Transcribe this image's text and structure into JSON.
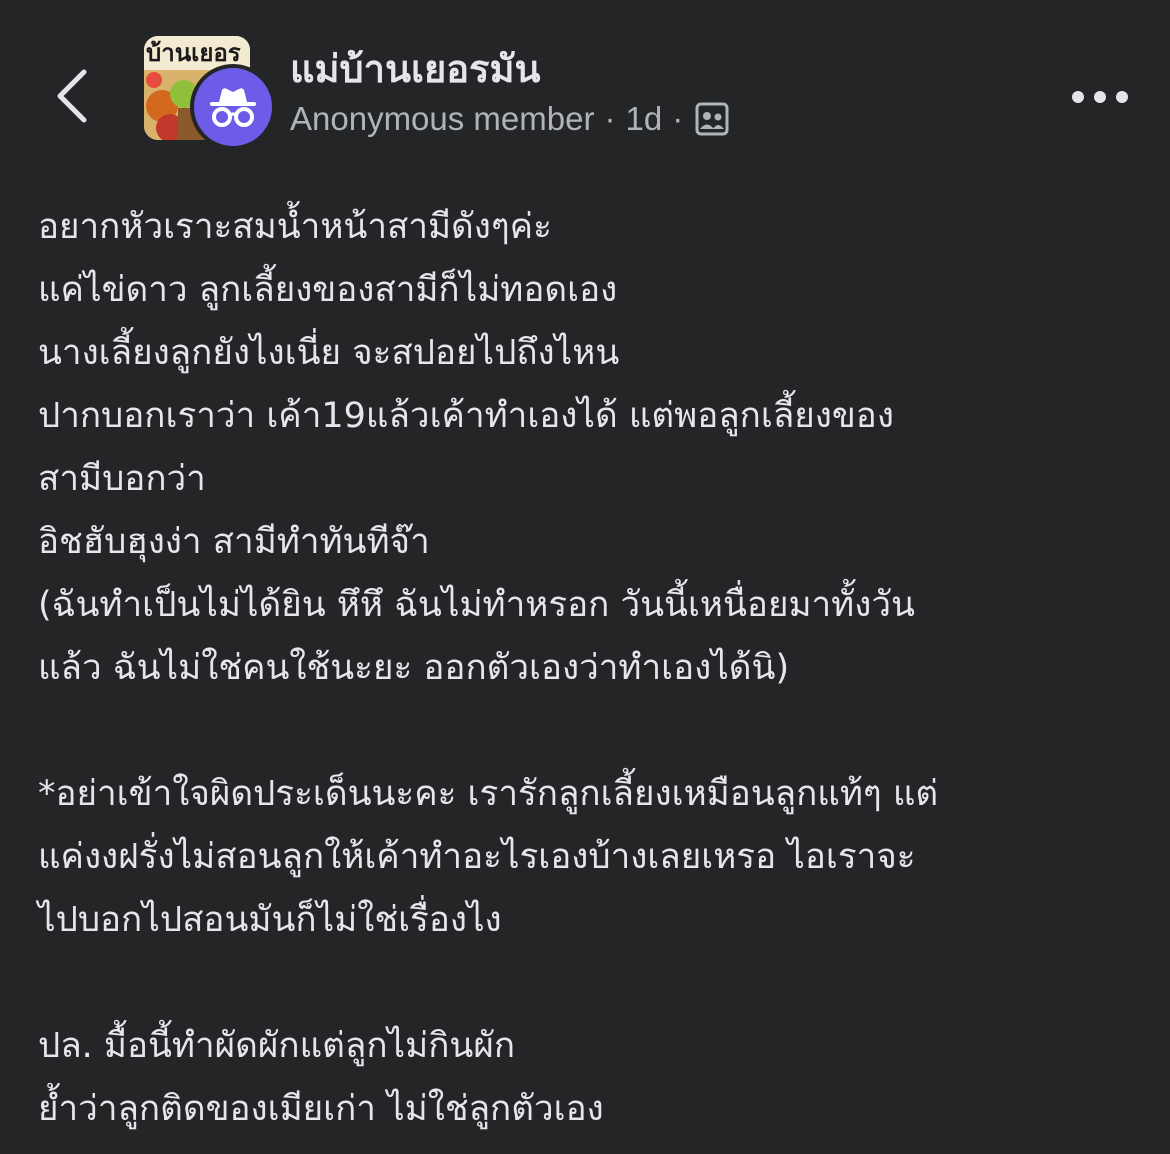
{
  "header": {
    "back_icon": "chevron-left-icon",
    "group_name": "แม่บ้านเยอรมัน",
    "group_photo_banner": "บ้านเยอร",
    "author": "Anonymous member",
    "separator": "·",
    "time": "1d",
    "privacy_icon": "group-members-icon",
    "more_icon": "more-horizontal-icon"
  },
  "post": {
    "paragraphs": [
      [
        "อยากหัวเราะสมน้ำหน้าสามีดังๆค่ะ",
        "แค่ไข่ดาว ลูกเลี้ยงของสามีก็ไม่ทอดเอง",
        "นางเลี้ยงลูกยังไงเนี่ย จะสปอยไปถึงไหน",
        "ปากบอกเราว่า เค้า19แล้วเค้าทำเองได้ แต่พอลูกเลี้ยงของ",
        "สามีบอกว่า",
        "อิชฮับฮุงง่า สามีทำทันทีจ๊า",
        "(ฉันทำเป็นไม่ได้ยิน หึหึ ฉันไม่ทำหรอก วันนี้เหนื่อยมาทั้งวัน",
        "แล้ว ฉันไม่ใช่คนใช้นะยะ ออกตัวเองว่าทำเองได้นิ)"
      ],
      [
        "*อย่าเข้าใจผิดประเด็นนะคะ เรารักลูกเลี้ยงเหมือนลูกแท้ๆ แต่",
        "แค่งงฝรั่งไม่สอนลูกให้เค้าทำอะไรเองบ้างเลยเหรอ ไอเราจะ",
        "ไปบอกไปสอนมันก็ไม่ใช่เรื่องไง"
      ],
      [
        "ปล. มื้อนี้ทำผัดผักแต่ลูกไม่กินผัก",
        "ย้ำว่าลูกติดของเมียเก่า ไม่ใช่ลูกตัวเอง"
      ]
    ]
  },
  "colors": {
    "background": "#242526",
    "primary_text": "#e4e6eb",
    "secondary_text": "#b0b3b8",
    "anon_badge": "#6c5ce7"
  }
}
